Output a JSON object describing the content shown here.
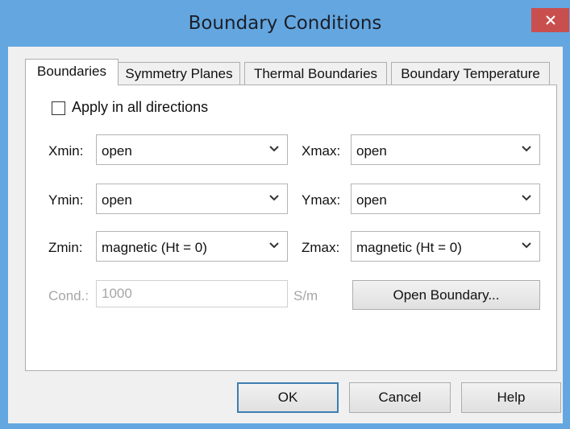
{
  "window": {
    "title": "Boundary Conditions",
    "close_glyph": "✕"
  },
  "tabs": [
    {
      "label": "Boundaries",
      "active": true
    },
    {
      "label": "Symmetry Planes",
      "active": false
    },
    {
      "label": "Thermal Boundaries",
      "active": false
    },
    {
      "label": "Boundary Temperature",
      "active": false
    }
  ],
  "apply_all": {
    "label": "Apply in all directions",
    "checked": false
  },
  "fields": {
    "xmin": {
      "label": "Xmin:",
      "value": "open"
    },
    "xmax": {
      "label": "Xmax:",
      "value": "open"
    },
    "ymin": {
      "label": "Ymin:",
      "value": "open"
    },
    "ymax": {
      "label": "Ymax:",
      "value": "open"
    },
    "zmin": {
      "label": "Zmin:",
      "value": "magnetic (Ht = 0)"
    },
    "zmax": {
      "label": "Zmax:",
      "value": "magnetic (Ht = 0)"
    }
  },
  "cond": {
    "label": "Cond.:",
    "value": "1000",
    "unit": "S/m",
    "enabled": false
  },
  "buttons": {
    "open_boundary": "Open Boundary...",
    "ok": "OK",
    "cancel": "Cancel",
    "help": "Help"
  },
  "icons": {
    "close": "close-icon",
    "dropdown": "chevron-down-icon"
  },
  "colors": {
    "titlebar": "#64a7e0",
    "close": "#c94f4f",
    "default_button_border": "#3c7fb1"
  }
}
